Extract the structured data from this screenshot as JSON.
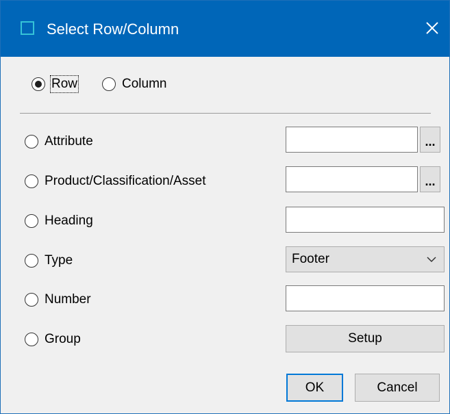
{
  "window": {
    "title": "Select Row/Column",
    "title_icon": "window-icon",
    "close_icon": "close-icon"
  },
  "orientation": {
    "row_label": "Row",
    "column_label": "Column",
    "selected": "Row"
  },
  "options": {
    "attribute_label": "Attribute",
    "product_label": "Product/Classification/Asset",
    "heading_label": "Heading",
    "type_label": "Type",
    "number_label": "Number",
    "group_label": "Group"
  },
  "fields": {
    "attribute_value": "",
    "product_value": "",
    "heading_value": "",
    "number_value": "",
    "browse_label": "...",
    "type_selected": "Footer",
    "setup_label": "Setup"
  },
  "buttons": {
    "ok_label": "OK",
    "cancel_label": "Cancel"
  },
  "colors": {
    "titlebar": "#0066b8",
    "icon_outline": "#35c3d7",
    "default_button_border": "#0078d7"
  }
}
